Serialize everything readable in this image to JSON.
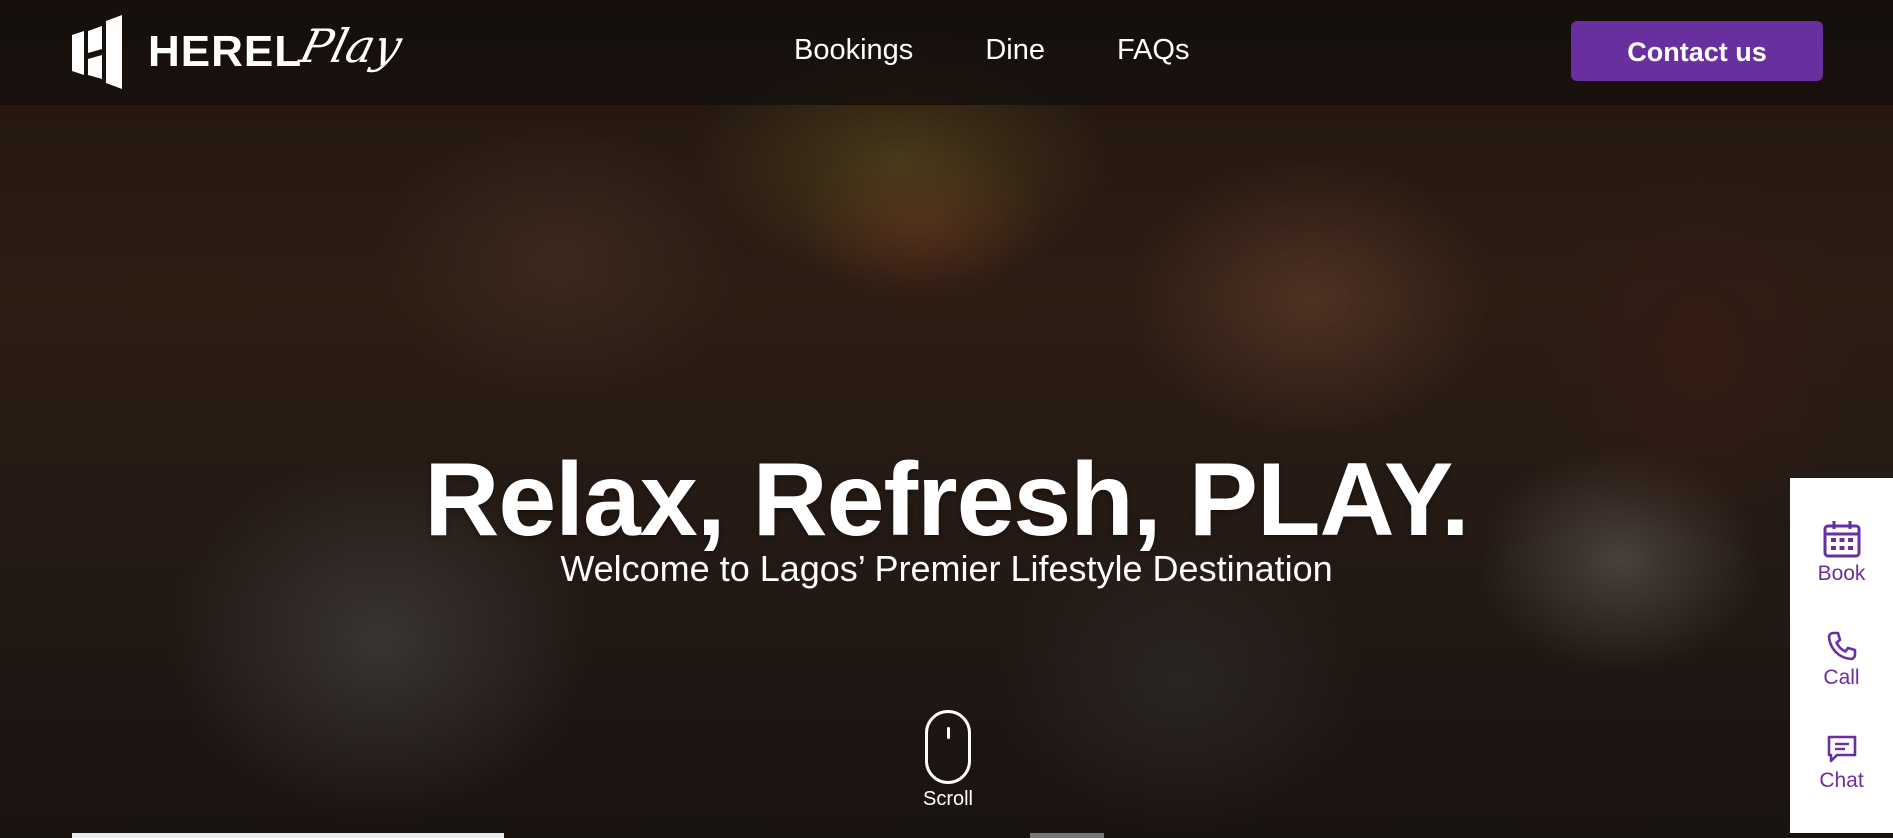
{
  "brand": {
    "wordmark": "HEREL",
    "script": "Play"
  },
  "nav": {
    "items": [
      "Bookings",
      "Dine",
      "FAQs"
    ],
    "contact_label": "Contact us"
  },
  "hero": {
    "headline": "Relax, Refresh, PLAY.",
    "subhead": "Welcome to Lagos’ Premier Lifestyle Destination",
    "scroll_label": "Scroll"
  },
  "quick_actions": [
    {
      "label": "Book",
      "icon": "calendar-icon"
    },
    {
      "label": "Call",
      "icon": "phone-icon"
    },
    {
      "label": "Chat",
      "icon": "chat-icon"
    }
  ],
  "colors": {
    "accent": "#6a2f9e",
    "header_bg": "rgba(18,14,12,0.72)",
    "panel_bg": "#ffffff",
    "text_light": "#ffffff"
  }
}
